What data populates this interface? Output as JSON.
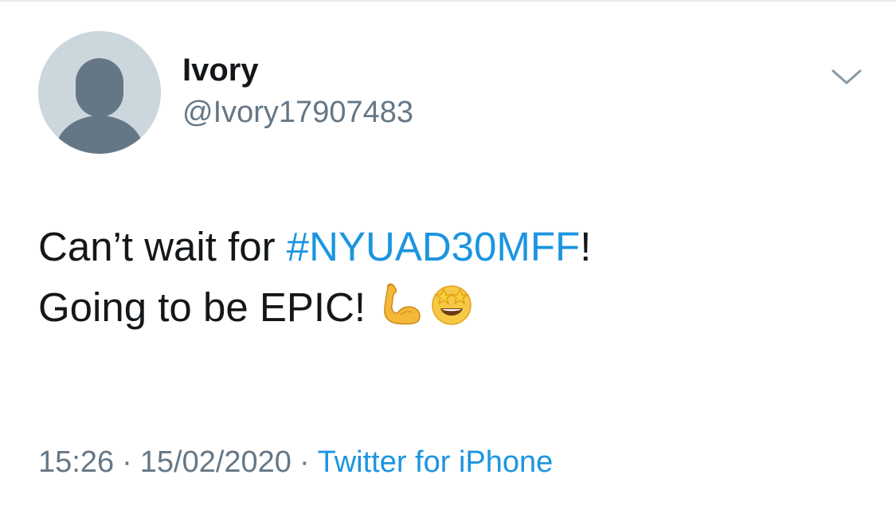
{
  "user": {
    "name": "Ivory",
    "handle": "@Ivory17907483"
  },
  "tweet": {
    "line1_prefix": "Can’t wait for ",
    "hashtag": "#NYUAD30MFF",
    "line1_suffix": "!",
    "line2_text": "Going to be EPIC!",
    "emojis": [
      "flexed-biceps-icon",
      "star-struck-icon"
    ]
  },
  "meta": {
    "time": "15:26",
    "separator": "·",
    "date": "15/02/2020",
    "source": "Twitter for iPhone"
  },
  "colors": {
    "text": "#14171a",
    "secondary": "#657786",
    "link": "#1b95e0",
    "avatar_bg": "#ccd6dd",
    "avatar_fg": "#657786"
  }
}
